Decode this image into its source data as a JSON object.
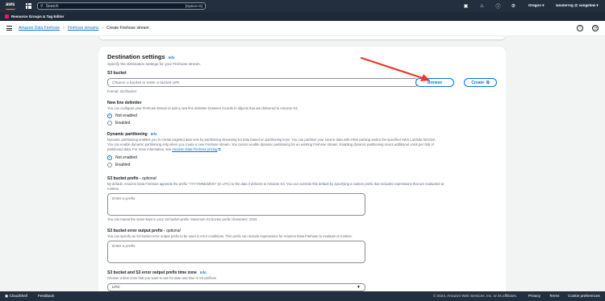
{
  "topnav": {
    "logo_text": "aws",
    "search_placeholder": "Search",
    "search_shortcut": "[Option+S]",
    "region": "Oregon ▾",
    "account": "wouterrvg @ vangelow ▾"
  },
  "subnav": {
    "label": "Resource Groups & Tag Editor"
  },
  "header": {
    "breadcrumb": [
      "Amazon Data Firehose",
      "Firehose streams",
      "Create Firehose stream"
    ]
  },
  "destination": {
    "title": "Destination settings",
    "info": "Info",
    "description": "Specify the destination settings for your Firehose stream.",
    "s3_bucket_label": "S3 bucket",
    "s3_bucket_placeholder": "Choose a bucket or enter a bucket URI",
    "browse_label": "Browse",
    "create_label": "Create",
    "format_hint": "Format: s3://bucket",
    "newline_label": "New line delimiter",
    "newline_hint": "You can configure your Firehose stream to add a new line delimiter between records in objects that are delivered to Amazon S3.",
    "newline_options": [
      "Not enabled",
      "Enabled"
    ],
    "newline_selected": "Not enabled",
    "dyn_label": "Dynamic partitioning",
    "dyn_info": "Info",
    "dyn_hint_1": "Dynamic partitioning enables you to create targeted data sets by partitioning streaming S3 data based on partitioning keys. You can partition your source data with inline parsing and/or the specified AWS Lambda function.",
    "dyn_hint_2": "You can enable dynamic partitioning only when you create a new Firehose stream. You cannot enable dynamic partitioning for an existing Firehose stream. Enabling dynamic partitioning incurs additional costs per GiB of",
    "dyn_hint_3_prefix": "partitioned data. For more information, see ",
    "dyn_hint_3_link": "Amazon Data Firehose pricing",
    "dyn_options": [
      "Not enabled",
      "Enabled"
    ],
    "prefix_label": "S3 bucket prefix - ",
    "prefix_optional": "optional",
    "prefix_hint_1": "By default, Amazon Data Firehose appends the prefix \"YYYY/MM/dd/HH\" (in UTC) to the data it delivers to Amazon S3. You can override this default by specifying a custom prefix that includes expressions that are evaluated at",
    "prefix_hint_2": "runtime.",
    "prefix_placeholder": "Enter a prefix",
    "prefix_footer": "You can repeat the same keys in your S3 bucket prefix. Maximum S3 bucket prefix characters: 1024.",
    "error_prefix_label": "S3 bucket error output prefix - ",
    "error_prefix_optional": "optional",
    "error_prefix_hint": "You can specify an S3 bucket error output prefix to be used in error conditions. This prefix can include expressions for Amazon Data Firehose to evaluate at runtime.",
    "error_prefix_placeholder": "Enter a prefix",
    "tz_label": "S3 bucket and S3 error output prefix time zone",
    "tz_info": "Info",
    "tz_hint": "Choose a time zone that you want to use for date and time in S3 prefixes",
    "tz_value": "UTC"
  },
  "footer": {
    "cloudshell": "CloudShell",
    "feedback": "Feedback",
    "copyright": "© 2024, Amazon Web Services, Inc. or its affiliates.",
    "privacy": "Privacy",
    "terms": "Terms",
    "cookies": "Cookie preferences"
  },
  "colors": {
    "nav_bg": "#232f3e",
    "link": "#0972d3",
    "annotation_arrow": "#e8392a"
  }
}
